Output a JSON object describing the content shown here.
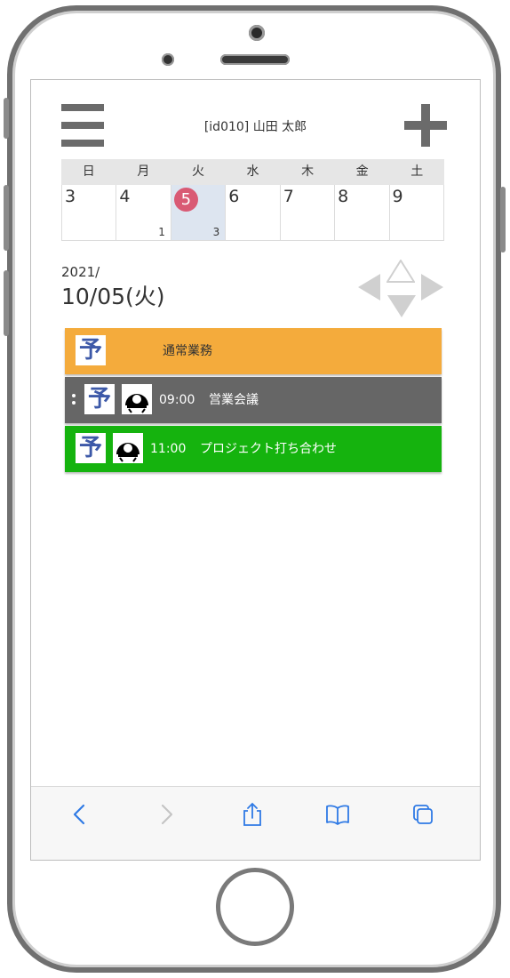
{
  "header": {
    "user_label": "[id010] 山田 太郎"
  },
  "week": {
    "headers": [
      "日",
      "月",
      "火",
      "水",
      "木",
      "金",
      "土"
    ],
    "days": [
      {
        "num": "3",
        "count": ""
      },
      {
        "num": "4",
        "count": "1"
      },
      {
        "num": "5",
        "count": "3"
      },
      {
        "num": "6",
        "count": ""
      },
      {
        "num": "7",
        "count": ""
      },
      {
        "num": "8",
        "count": ""
      },
      {
        "num": "9",
        "count": ""
      }
    ],
    "selected_index": 2,
    "today_color": "#d95a74"
  },
  "date": {
    "year": "2021/",
    "day": "10/05(火)"
  },
  "events": [
    {
      "badge": "予",
      "time": "",
      "title": "通常業務",
      "color": "#f4ab3c",
      "text_color": "#333333"
    },
    {
      "badge": "予",
      "time": "09:00",
      "title": "営業会議",
      "color": "#666666",
      "text_color": "#ffffff"
    },
    {
      "badge": "予",
      "time": "11:00",
      "title": "プロジェクト打ち合わせ",
      "color": "#15b30e",
      "text_color": "#ffffff"
    }
  ],
  "toolbar": {
    "icons": [
      "back-icon",
      "forward-icon",
      "share-icon",
      "bookmarks-icon",
      "tabs-icon"
    ],
    "accent": "#2f7ae5"
  }
}
